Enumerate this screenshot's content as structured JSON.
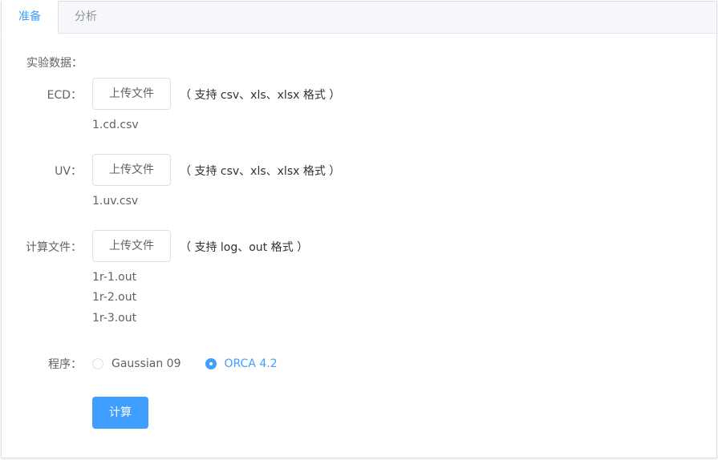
{
  "tabs": [
    {
      "label": "准备",
      "active": true
    },
    {
      "label": "分析",
      "active": false
    }
  ],
  "form": {
    "section_title": "实验数据：",
    "ecd": {
      "label": "ECD：",
      "button": "上传文件",
      "hint": "（ 支持 csv、xls、xlsx 格式 ）",
      "files": [
        "1.cd.csv"
      ]
    },
    "uv": {
      "label": "UV：",
      "button": "上传文件",
      "hint": "（ 支持 csv、xls、xlsx 格式 ）",
      "files": [
        "1.uv.csv"
      ]
    },
    "calc": {
      "label": "计算文件：",
      "button": "上传文件",
      "hint": "（ 支持 log、out 格式 ）",
      "files": [
        "1r-1.out",
        "1r-2.out",
        "1r-3.out"
      ]
    },
    "program": {
      "label": "程序：",
      "options": [
        {
          "label": "Gaussian 09",
          "checked": false
        },
        {
          "label": "ORCA 4.2",
          "checked": true
        }
      ]
    },
    "submit": "计算"
  },
  "colors": {
    "accent": "#409eff",
    "border": "#dcdfe6",
    "text": "#606266",
    "tab_header_bg": "#f5f7fa"
  }
}
